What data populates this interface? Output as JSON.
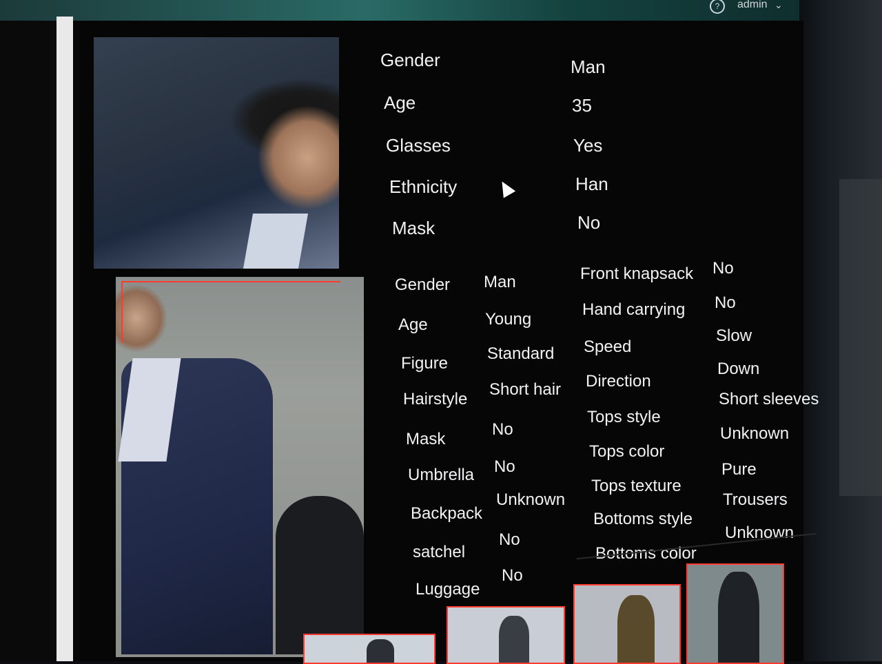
{
  "header": {
    "user": "admin",
    "help_icon": "help-circle-icon",
    "dropdown_icon": "chevron-down-icon"
  },
  "face_attributes": [
    {
      "label": "Gender",
      "value": "Man"
    },
    {
      "label": "Age",
      "value": "35"
    },
    {
      "label": "Glasses",
      "value": "Yes"
    },
    {
      "label": "Ethnicity",
      "value": "Han"
    },
    {
      "label": "Mask",
      "value": "No"
    }
  ],
  "body_attributes_left": [
    {
      "label": "Gender",
      "value": "Man"
    },
    {
      "label": "Age",
      "value": "Young"
    },
    {
      "label": "Figure",
      "value": "Standard"
    },
    {
      "label": "Hairstyle",
      "value": "Short hair"
    },
    {
      "label": "Mask",
      "value": "No"
    },
    {
      "label": "Umbrella",
      "value": "No"
    },
    {
      "label": "Backpack",
      "value": "Unknown"
    },
    {
      "label": "satchel",
      "value": "No"
    },
    {
      "label": "Luggage",
      "value": "No"
    }
  ],
  "body_attributes_right": [
    {
      "label": "Front knapsack",
      "value": "No"
    },
    {
      "label": "Hand carrying",
      "value": "No"
    },
    {
      "label": "Speed",
      "value": "Slow"
    },
    {
      "label": "Direction",
      "value": "Down"
    },
    {
      "label": "Tops style",
      "value": "Short sleeves"
    },
    {
      "label": "Tops color",
      "value": "Unknown"
    },
    {
      "label": "Tops texture",
      "value": "Pure"
    },
    {
      "label": "Bottoms style",
      "value": "Trousers"
    },
    {
      "label": "Bottoms color",
      "value": "Unknown"
    }
  ],
  "colors": {
    "accent": "#ff3b30",
    "background": "#060606",
    "text": "#f1f2f4"
  }
}
